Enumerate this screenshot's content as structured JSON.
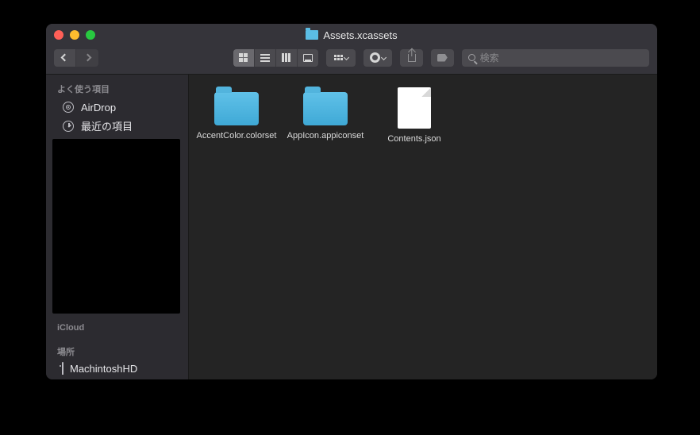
{
  "window": {
    "title": "Assets.xcassets"
  },
  "toolbar": {
    "search_placeholder": "検索"
  },
  "sidebar": {
    "favorites_header": "よく使う項目",
    "favorites": [
      {
        "label": "AirDrop"
      },
      {
        "label": "最近の項目"
      }
    ],
    "icloud_header": "iCloud",
    "locations_header": "場所",
    "locations": [
      {
        "label": "MachintoshHD"
      }
    ]
  },
  "content": {
    "items": [
      {
        "kind": "folder",
        "name": "AccentColor.colorset"
      },
      {
        "kind": "folder",
        "name": "AppIcon.appiconset"
      },
      {
        "kind": "file",
        "name": "Contents.json"
      }
    ]
  }
}
